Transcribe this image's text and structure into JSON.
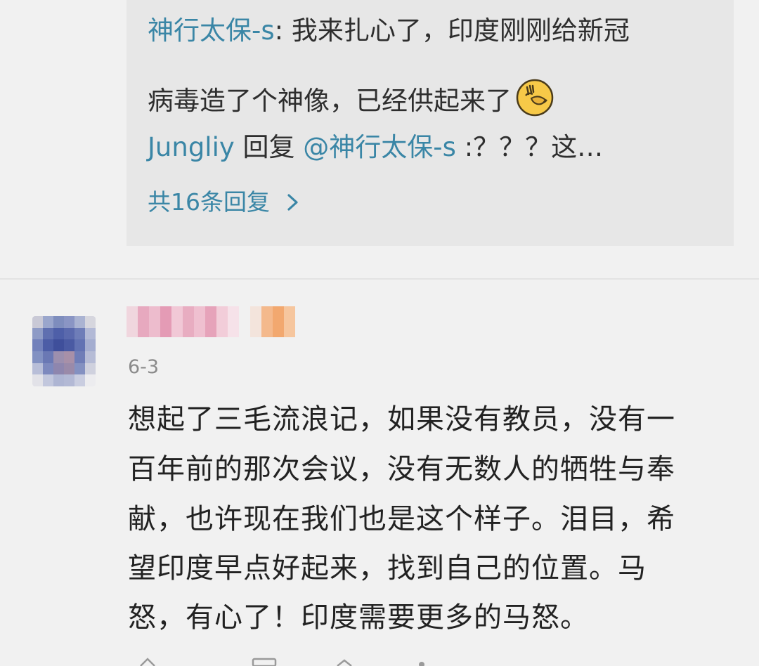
{
  "reply_box": {
    "line1": {
      "author": "神行太保-s",
      "separator": ": ",
      "text": "我来扎心了，印度刚刚给新冠"
    },
    "line2_text": "病毒造了个神像，已经供起来了",
    "line2_emoji": "face-palm-emoji",
    "line3": {
      "author": "Jungliy",
      "reply_word": " 回复 ",
      "mention": "@神行太保-s",
      "text": " :？？？这…"
    },
    "more_replies": "共16条回复",
    "more_icon": "chevron-right-icon",
    "accent_color": "#3a86a6"
  },
  "comment": {
    "timestamp": "6-3",
    "avatar_icon": "pixelated-avatar",
    "lines": [
      "想起了三毛流浪记，如果没有教员，没有一",
      "百年前的那次会议，没有无数人的牺牲与奉",
      "献，也许现在我们也是这个样子。泪目，希",
      "望印度早点好起来，找到自己的位置。马",
      "怒，有心了！印度需要更多的马怒。"
    ]
  }
}
